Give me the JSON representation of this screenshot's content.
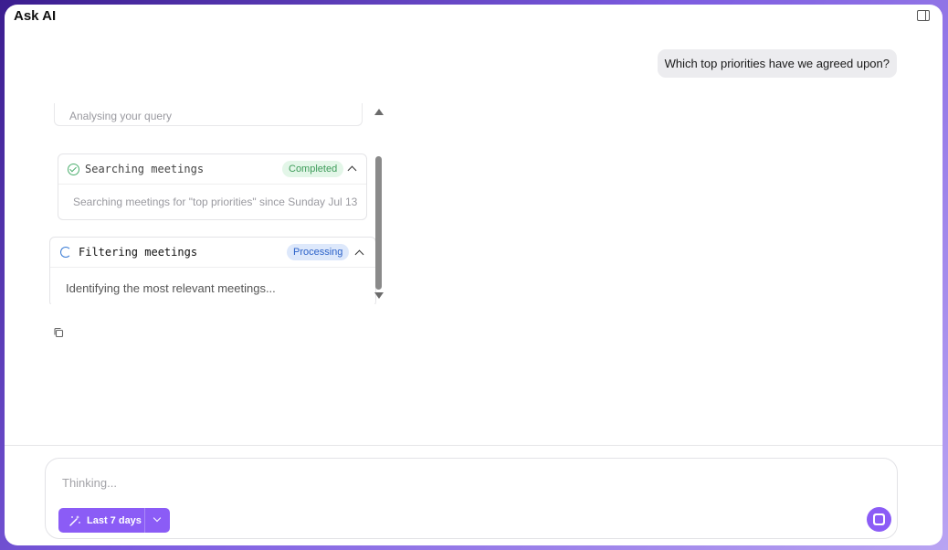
{
  "header": {
    "title": "Ask AI",
    "panel_icon": "panel-right-icon"
  },
  "conversation": {
    "user_message": "Which top priorities have we agreed upon?",
    "steps": [
      {
        "name": "",
        "status": "",
        "description": "Analysing your query"
      },
      {
        "name": "Searching meetings",
        "status": "Completed",
        "description": "Searching meetings for \"top priorities\" since Sunday Jul 13"
      },
      {
        "name": "Filtering meetings",
        "status": "Processing",
        "description": "Identifying the most relevant meetings..."
      }
    ],
    "copy_icon": "copy-icon"
  },
  "composer": {
    "placeholder": "Thinking...",
    "range_label": "Last 7 days",
    "range_icon": "magic-wand-icon",
    "stop_icon": "stop-icon"
  },
  "colors": {
    "accent": "#8b5cf6",
    "completed_bg": "#e3f6e8",
    "completed_text": "#3e9c5a",
    "processing_bg": "#dde8fb",
    "processing_text": "#2c62c9"
  }
}
